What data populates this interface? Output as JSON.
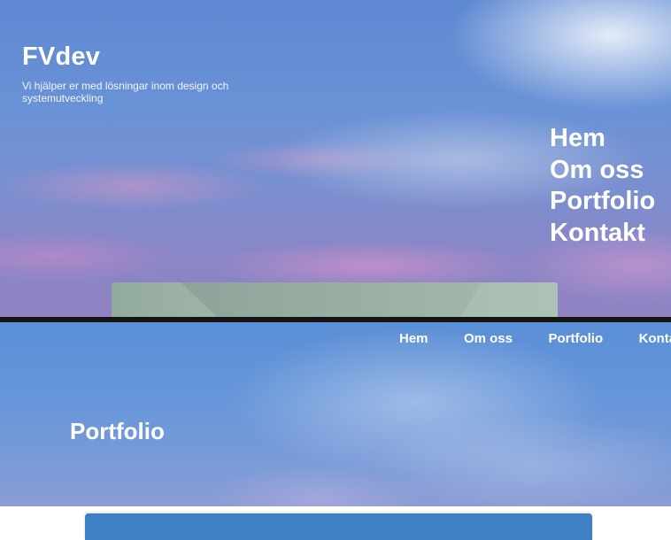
{
  "hero": {
    "brand": "FVdev",
    "tagline": "Vi hjälper er med lösningar inom design och systemutveckling",
    "nav": [
      "Hem",
      "Om oss",
      "Portfolio",
      "Kontakt"
    ]
  },
  "header": {
    "nav": [
      "Hem",
      "Om oss",
      "Portfolio",
      "Konta"
    ]
  },
  "portfolio": {
    "title": "Portfolio"
  },
  "colors": {
    "accent": "#3f7fc4",
    "divider": "#141414"
  }
}
